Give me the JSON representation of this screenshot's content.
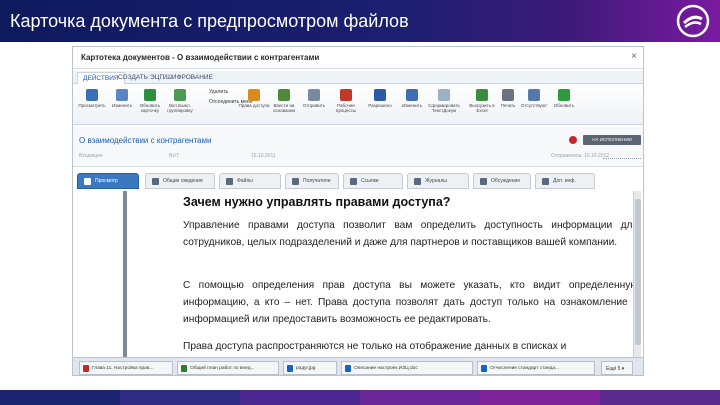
{
  "slide": {
    "title": "Карточка документа с предпросмотром файлов"
  },
  "window": {
    "title": "Картотека документов - О взаимодействии с контрагентами",
    "close": "×",
    "ribbon_tabs": [
      "ДЕЙСТВИЯ",
      "СОЗДАТЬ",
      "ЭЦП/ШИФРОВАНИЕ"
    ],
    "toolbar": [
      {
        "label": "Просмотреть",
        "color": "#3b6fb6",
        "icon": "view-icon"
      },
      {
        "label": "Изменить",
        "color": "#5a84c2",
        "icon": "edit-icon"
      },
      {
        "label": "Обновить карточку",
        "color": "#2c8f3f",
        "icon": "refresh-icon"
      },
      {
        "label": "Вкл./выкл. группировку",
        "color": "#4e9a52",
        "icon": "group-icon"
      },
      {
        "label": "Права доступа",
        "color": "#d88a1e",
        "icon": "rights-icon"
      },
      {
        "label": "Ввести на основании",
        "color": "#4e8a3a",
        "icon": "base-icon"
      },
      {
        "label": "Отправить",
        "color": "#7a8a9e",
        "icon": "send-icon"
      },
      {
        "label": "Рабочие процессы",
        "color": "#c0392b",
        "icon": "workflow-icon"
      },
      {
        "label": "Разрешено",
        "color": "#2d5aa8",
        "icon": "allowed-icon"
      },
      {
        "label": "Изменить",
        "color": "#3f6fb2",
        "icon": "change-icon"
      },
      {
        "label": "Сформировать ТекстДокум",
        "color": "#9db0c6",
        "icon": "form-icon"
      },
      {
        "label": "Выгрузить в Excel",
        "color": "#3b8c3b",
        "icon": "excel-icon"
      },
      {
        "label": "Печать",
        "color": "#6a7480",
        "icon": "print-icon"
      },
      {
        "label": "Отсутствуют",
        "color": "#5577aa",
        "icon": "absent-icon"
      },
      {
        "label": "Обновить",
        "color": "#2e9a3e",
        "icon": "update-icon"
      }
    ],
    "toolbar_small": [
      "Удалить",
      "Отсоединить меня"
    ],
    "doc": {
      "title": "О взаимодействии с контрагентами",
      "status_button": "НА ИСПОЛНЕНИИ",
      "meta_left": "Входящее",
      "meta_no": "Вх/7",
      "meta_date": "16.10.2011",
      "meta_right": "Отправитель: 16.10.2012"
    },
    "tabs": [
      {
        "label": "Просмотр",
        "active": true
      },
      {
        "label": "Общие сведения",
        "active": false
      },
      {
        "label": "Файлы",
        "active": false
      },
      {
        "label": "Получатели",
        "active": false
      },
      {
        "label": "Ссылки",
        "active": false
      },
      {
        "label": "Журналы",
        "active": false
      },
      {
        "label": "Обсуждение",
        "active": false
      },
      {
        "label": "Доп. инф.",
        "active": false
      }
    ],
    "preview": {
      "heading": "Зачем нужно управлять правами доступа?",
      "p1": "Управление правами доступа позволит вам определить доступность информации для сотрудников, целых подразделений и даже для партнеров и поставщиков вашей компании.",
      "p2": "С помощью определения прав доступа вы можете указать, кто видит определенную информацию, а кто – нет. Права доступа позволят дать доступ только на ознакомление с информацией или предоставить возможность ее редактировать.",
      "p3": "Права доступа распространяются не только на отображение данных в списках и"
    },
    "bottom_files": [
      {
        "label": "Глава 11. Настройка прав...",
        "color": "#c62828"
      },
      {
        "label": "Общий план работ по внед...",
        "color": "#2e7d32"
      },
      {
        "label": "радуг.jpg",
        "color": "#1565c0"
      },
      {
        "label": "Описание настроек ИЗЦ.doc",
        "color": "#1565c0"
      },
      {
        "label": "Отчисление стандарт станда...",
        "color": "#1565c0"
      }
    ],
    "page_indicator": "Ещё 5 ▾"
  },
  "footer_colors": [
    "#1a2370",
    "#2f2a84",
    "#4b2891",
    "#6a2597",
    "#7e239a",
    "#5a2a8e"
  ]
}
